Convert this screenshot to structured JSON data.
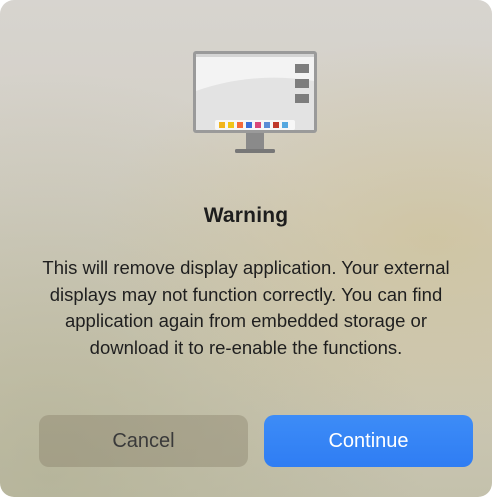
{
  "dialog": {
    "title": "Warning",
    "message": "This will remove display application. Your external displays may not function correctly. You can find application again from embedded storage or download it to re-enable the functions.",
    "icon": "monitor-icon"
  },
  "buttons": {
    "cancel_label": "Cancel",
    "continue_label": "Continue"
  },
  "colors": {
    "accent": "#2f7df3",
    "title_text": "#1d1d1d"
  }
}
